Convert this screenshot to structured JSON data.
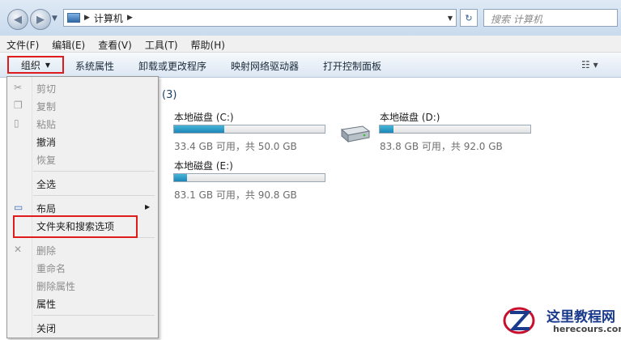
{
  "address": {
    "crumb": "计算机"
  },
  "search": {
    "placeholder": "搜索 计算机"
  },
  "menubar": [
    "文件(F)",
    "编辑(E)",
    "查看(V)",
    "工具(T)",
    "帮助(H)"
  ],
  "toolbar": {
    "organize": "组织",
    "system_properties": "系统属性",
    "uninstall": "卸载或更改程序",
    "map_drive": "映射网络驱动器",
    "control_panel": "打开控制面板"
  },
  "group_count": "(3)",
  "drives": [
    {
      "name": "本地磁盘 (C:)",
      "info": "33.4 GB 可用，共 50.0 GB",
      "used_fraction": 0.332
    },
    {
      "name": "本地磁盘 (D:)",
      "info": "83.8 GB 可用，共 92.0 GB",
      "used_fraction": 0.089
    },
    {
      "name": "本地磁盘 (E:)",
      "info": "83.1 GB 可用，共 90.8 GB",
      "used_fraction": 0.085
    }
  ],
  "organize_menu": {
    "cut": "剪切",
    "copy": "复制",
    "paste": "粘贴",
    "undo": "撤消",
    "redo": "恢复",
    "select_all": "全选",
    "layout": "布局",
    "folder_options": "文件夹和搜索选项",
    "delete": "删除",
    "rename": "重命名",
    "remove_properties": "删除属性",
    "properties": "属性",
    "close": "关闭"
  },
  "watermark": {
    "title": "这里教程网",
    "url": "herecours.com"
  }
}
